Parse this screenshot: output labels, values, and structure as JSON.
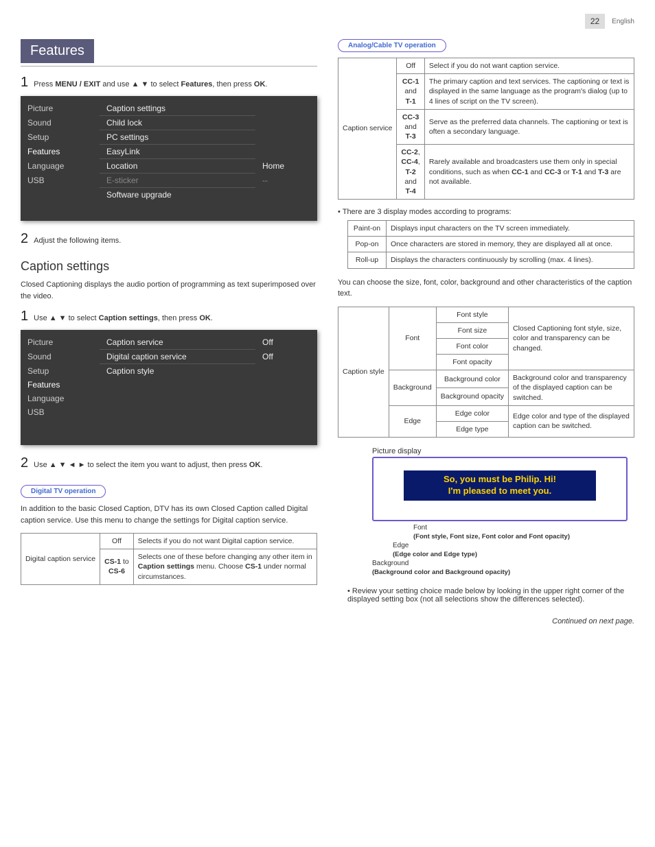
{
  "page": {
    "number": "22",
    "language": "English"
  },
  "features": {
    "title": "Features",
    "step1_pre": "Press ",
    "step1_b1": "MENU / EXIT",
    "step1_mid": " and use ▲ ▼ to select ",
    "step1_b2": "Features",
    "step1_post": ", then press ",
    "step1_b3": "OK",
    "step1_end": ".",
    "menu_left": [
      "Picture",
      "Sound",
      "Setup",
      "Features",
      "Language",
      "USB"
    ],
    "menu_rows": [
      {
        "label": "Caption settings",
        "val": ""
      },
      {
        "label": "Child lock",
        "val": ""
      },
      {
        "label": "PC settings",
        "val": ""
      },
      {
        "label": "EasyLink",
        "val": ""
      },
      {
        "label": "Location",
        "val": "Home"
      },
      {
        "label": "E-sticker",
        "val": "--",
        "dim": true
      },
      {
        "label": "Software upgrade",
        "val": ""
      }
    ],
    "step2": "Adjust the following items."
  },
  "caption": {
    "heading": "Caption settings",
    "intro": "Closed Captioning displays the audio portion of programming as text superimposed over the video.",
    "step1_pre": "Use ▲ ▼ to select ",
    "step1_b1": "Caption settings",
    "step1_mid": ", then press ",
    "step1_b2": "OK",
    "step1_end": ".",
    "menu_left": [
      "Picture",
      "Sound",
      "Setup",
      "Features",
      "Language",
      "USB"
    ],
    "menu_rows": [
      {
        "label": "Caption service",
        "val": "Off"
      },
      {
        "label": "Digital caption service",
        "val": "Off"
      },
      {
        "label": "Caption style",
        "val": ""
      }
    ],
    "step2_pre": "Use ▲ ▼ ◄ ► to select the item you want to adjust, then press ",
    "step2_b": "OK",
    "step2_end": "."
  },
  "digital_op": {
    "label": "Digital TV operation",
    "intro": "In addition to the basic Closed Caption, DTV has its own Closed Caption called Digital caption service. Use this menu to change the settings for Digital caption service.",
    "row_label": "Digital caption service",
    "rows": [
      {
        "k": "Off",
        "v": "Selects if you do not want Digital caption service."
      },
      {
        "k_html": "<b>CS-1</b> to <b>CS-6</b>",
        "v_html": "Selects one of these before changing any other item in <b>Caption settings</b> menu. Choose <b>CS-1</b> under normal circumstances."
      }
    ]
  },
  "analog_op": {
    "label": "Analog/Cable TV operation",
    "row_label": "Caption service",
    "rows": [
      {
        "k": "Off",
        "v": "Select if you do not want caption service."
      },
      {
        "k_html": "<b>CC-1</b><br>and<br><b>T-1</b>",
        "v": "The primary caption and text services. The captioning or text is displayed in the same language as the program's dialog (up to 4 lines of script on the TV screen)."
      },
      {
        "k_html": "<b>CC-3</b><br>and<br><b>T-3</b>",
        "v": "Serve as the preferred data channels. The captioning or text is often a secondary language."
      },
      {
        "k_html": "<b>CC-2</b>,<br><b>CC-4</b>,<br><b>T-2</b><br>and<br><b>T-4</b>",
        "v_html": "Rarely available and broadcasters use them only in special conditions, such as when <b>CC-1</b> and <b>CC-3</b> or <b>T-1</b> and <b>T-3</b> are not available."
      }
    ]
  },
  "modes": {
    "intro": "There are 3 display modes according to programs:",
    "rows": [
      {
        "k": "Paint-on",
        "v": "Displays input characters on the TV screen immediately."
      },
      {
        "k": "Pop-on",
        "v": "Once characters are stored in memory, they are displayed all at once."
      },
      {
        "k": "Roll-up",
        "v": "Displays the characters continuously by scrolling (max. 4 lines)."
      }
    ]
  },
  "style": {
    "intro": "You can choose the size, font, color, background and other characteristics of the caption text.",
    "row_label": "Caption style",
    "groups": [
      {
        "g": "Font",
        "items": [
          "Font style",
          "Font size",
          "Font color",
          "Font opacity"
        ],
        "desc": "Closed Captioning font style, size, color and transparency can be changed."
      },
      {
        "g": "Background",
        "items": [
          "Background color",
          "Background opacity"
        ],
        "desc": "Background color and transparency of the displayed caption can be switched."
      },
      {
        "g": "Edge",
        "items": [
          "Edge color",
          "Edge type"
        ],
        "desc": "Edge color and type of the displayed caption can be switched."
      }
    ]
  },
  "diagram": {
    "picture_display": "Picture display",
    "line1": "So, you must be Philip. Hi!",
    "line2": "I'm pleased to meet you.",
    "font_lbl": "Font",
    "font_sub": "(Font style, Font size, Font color and Font opacity)",
    "edge_lbl": "Edge",
    "edge_sub": "(Edge color and Edge type)",
    "bg_lbl": "Background",
    "bg_sub": "(Background color and Background opacity)"
  },
  "review": "Review your setting choice made below by looking in the upper right corner of the displayed setting box (not all selections show the differences selected).",
  "continued": "Continued on next page."
}
